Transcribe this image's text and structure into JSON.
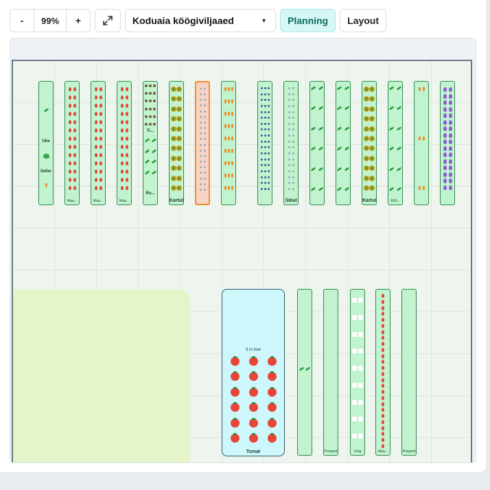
{
  "toolbar": {
    "zoom_out_label": "-",
    "zoom_value": "99%",
    "zoom_in_label": "+",
    "fit_icon": "expand-arrows-icon",
    "garden_name": "Koduaia köögiviljaaed",
    "planning_label": "Planning",
    "layout_label": "Layout",
    "active_mode": "Planning"
  },
  "colors": {
    "bed_fill": "#c1f3cf",
    "bed_border": "#2f8a4e",
    "selected_bed_fill": "#f9d3c5",
    "selected_bed_border": "#f08a2c",
    "tree_fill": "#cdf7fb",
    "zone_fill": "#e5f5c9",
    "planning_accent": "#0b6b62"
  },
  "beds_top": [
    {
      "label": "",
      "icon": "mixed",
      "texts": [
        "Ube",
        "Seller"
      ]
    },
    {
      "label": "Maa...",
      "icon": "strawberry-icon"
    },
    {
      "label": "Maa...",
      "icon": "strawberry-icon"
    },
    {
      "label": "Maa...",
      "icon": "strawberry-icon"
    },
    {
      "label": "",
      "icon": "mixed-dots-icon",
      "texts": [
        "Ti...",
        "Ro..."
      ]
    },
    {
      "label": "Kartul",
      "icon": "potato-icon"
    },
    {
      "label": "",
      "icon": "flower-icon",
      "selected": true
    },
    {
      "label": "",
      "icon": "mixed-rows-icon"
    },
    {
      "label": "",
      "icon": "blue-dot-icon"
    },
    {
      "label": "Sibul",
      "icon": "onion-icon"
    },
    {
      "label": "",
      "icon": "sprout-icon"
    },
    {
      "label": "",
      "icon": "sprout-icon"
    },
    {
      "label": "Kartul",
      "icon": "potato-icon"
    },
    {
      "label": "Kõõ...",
      "icon": "sprout-icon"
    },
    {
      "label": "",
      "icon": "carrot-icon"
    },
    {
      "label": "",
      "icon": "eggplant-icon"
    }
  ],
  "tree": {
    "title": "3 m tree",
    "label": "Tomat",
    "icon": "tomato-icon"
  },
  "beds_bottom": [
    {
      "label": "",
      "icon": "leaf-icon"
    },
    {
      "label": "Porgand",
      "icon": "none"
    },
    {
      "label": "Lõug",
      "icon": "square-icon"
    },
    {
      "label": "Maa...",
      "icon": "strawberry-icon"
    },
    {
      "label": "Porgand",
      "icon": "none"
    }
  ]
}
